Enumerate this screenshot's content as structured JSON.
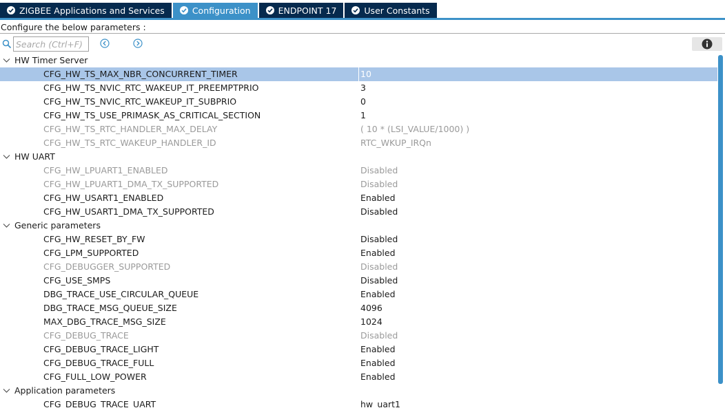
{
  "tabs": [
    {
      "label": "ZIGBEE Applications and Services",
      "active": false
    },
    {
      "label": "Configuration",
      "active": true
    },
    {
      "label": "ENDPOINT 17",
      "active": false
    },
    {
      "label": "User Constants",
      "active": false
    }
  ],
  "header": {
    "label": "Configure the below parameters :"
  },
  "search": {
    "placeholder": "Search (Ctrl+F)"
  },
  "colors": {
    "accent": "#3c91c8",
    "tab_dark": "#062a4e",
    "selection": "#a9c6e8",
    "disabled_text": "#9a9a9a"
  },
  "groups": [
    {
      "title": "HW Timer Server",
      "params": [
        {
          "name": "CFG_HW_TS_MAX_NBR_CONCURRENT_TIMER",
          "value": "10",
          "enabled": true,
          "selected": true
        },
        {
          "name": "CFG_HW_TS_NVIC_RTC_WAKEUP_IT_PREEMPTPRIO",
          "value": "3",
          "enabled": true
        },
        {
          "name": "CFG_HW_TS_NVIC_RTC_WAKEUP_IT_SUBPRIO",
          "value": "0",
          "enabled": true
        },
        {
          "name": "CFG_HW_TS_USE_PRIMASK_AS_CRITICAL_SECTION",
          "value": "1",
          "enabled": true
        },
        {
          "name": "CFG_HW_TS_RTC_HANDLER_MAX_DELAY",
          "value": "( 10 * (LSI_VALUE/1000) )",
          "enabled": false
        },
        {
          "name": "CFG_HW_TS_RTC_WAKEUP_HANDLER_ID",
          "value": "RTC_WKUP_IRQn",
          "enabled": false
        }
      ]
    },
    {
      "title": "HW UART",
      "params": [
        {
          "name": "CFG_HW_LPUART1_ENABLED",
          "value": "Disabled",
          "enabled": false
        },
        {
          "name": "CFG_HW_LPUART1_DMA_TX_SUPPORTED",
          "value": "Disabled",
          "enabled": false
        },
        {
          "name": "CFG_HW_USART1_ENABLED",
          "value": "Enabled",
          "enabled": true
        },
        {
          "name": "CFG_HW_USART1_DMA_TX_SUPPORTED",
          "value": "Disabled",
          "enabled": true
        }
      ]
    },
    {
      "title": "Generic parameters",
      "params": [
        {
          "name": "CFG_HW_RESET_BY_FW",
          "value": "Disabled",
          "enabled": true
        },
        {
          "name": "CFG_LPM_SUPPORTED",
          "value": "Enabled",
          "enabled": true
        },
        {
          "name": "CFG_DEBUGGER_SUPPORTED",
          "value": "Disabled",
          "enabled": false
        },
        {
          "name": "CFG_USE_SMPS",
          "value": "Disabled",
          "enabled": true
        },
        {
          "name": "DBG_TRACE_USE_CIRCULAR_QUEUE",
          "value": "Enabled",
          "enabled": true
        },
        {
          "name": "DBG_TRACE_MSG_QUEUE_SIZE",
          "value": "4096",
          "enabled": true
        },
        {
          "name": "MAX_DBG_TRACE_MSG_SIZE",
          "value": "1024",
          "enabled": true
        },
        {
          "name": "CFG_DEBUG_TRACE",
          "value": "Disabled",
          "enabled": false
        },
        {
          "name": "CFG_DEBUG_TRACE_LIGHT",
          "value": "Enabled",
          "enabled": true
        },
        {
          "name": "CFG_DEBUG_TRACE_FULL",
          "value": "Enabled",
          "enabled": true
        },
        {
          "name": "CFG_FULL_LOW_POWER",
          "value": "Enabled",
          "enabled": true
        }
      ]
    },
    {
      "title": "Application parameters",
      "params": [
        {
          "name": "CFG_DEBUG_TRACE_UART",
          "value": "hw_uart1",
          "enabled": true
        }
      ]
    }
  ]
}
